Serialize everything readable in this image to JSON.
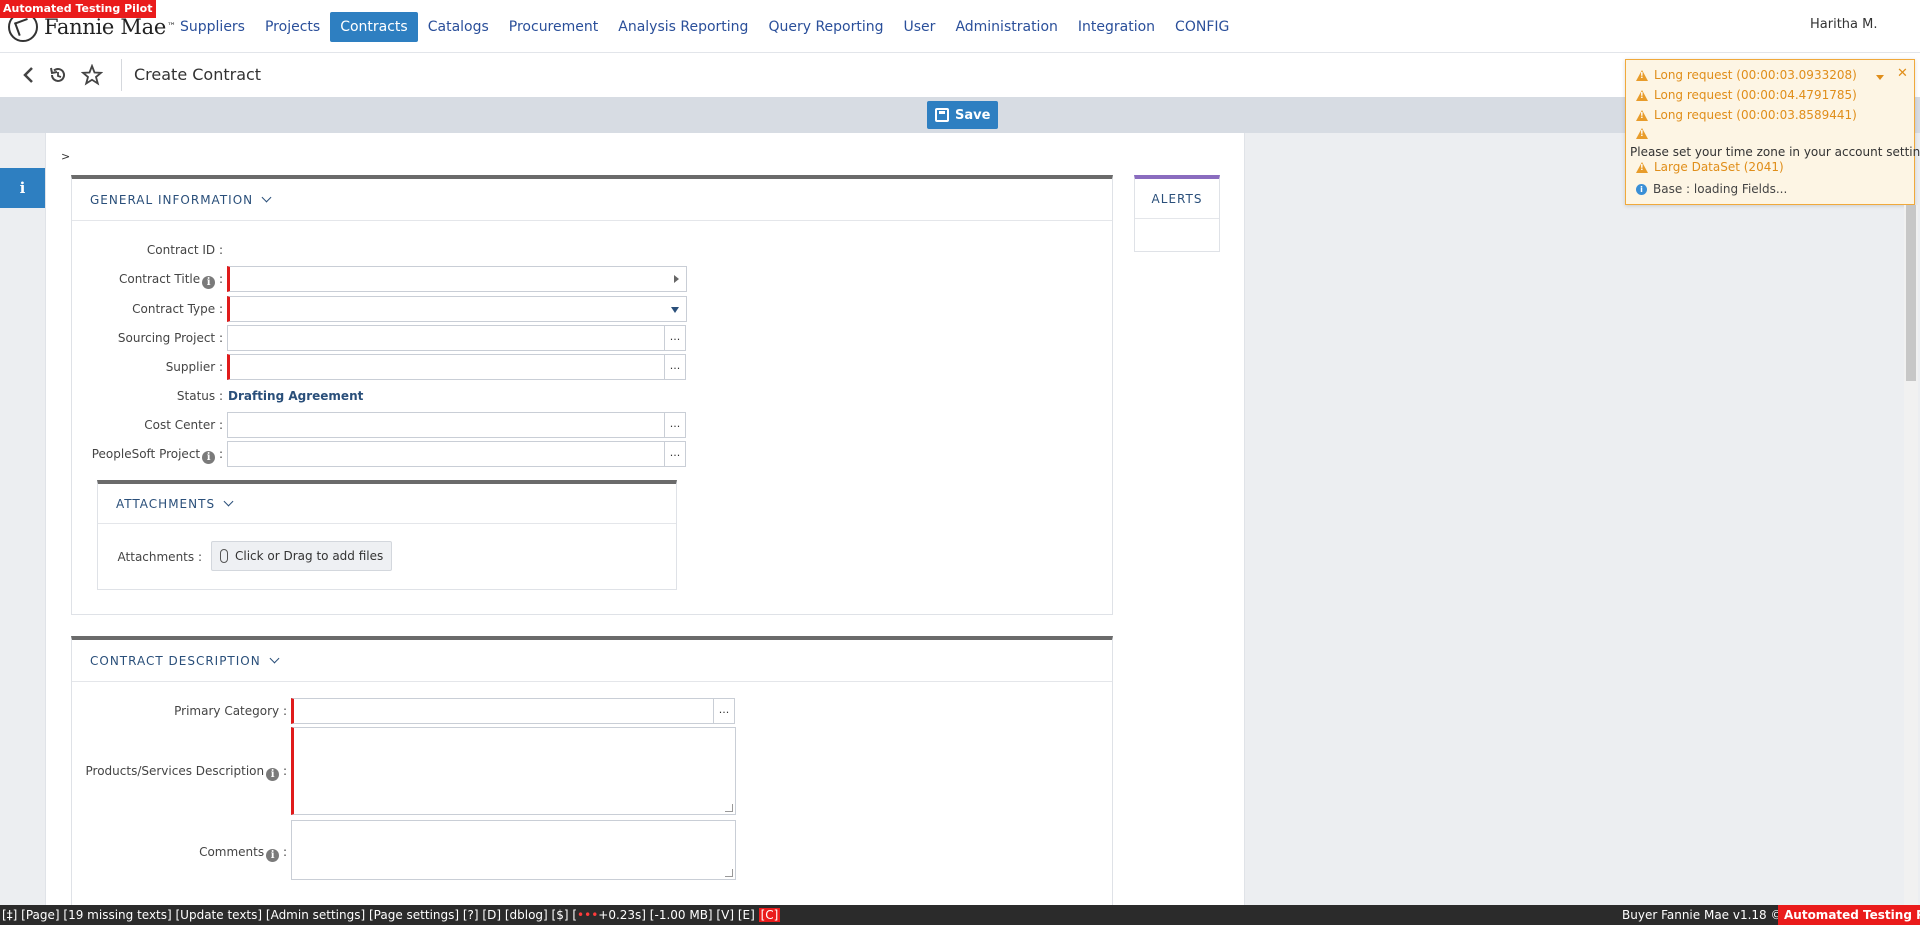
{
  "badges": {
    "top": "Automated Testing Pilot",
    "bottom": "Automated Testing Pilot"
  },
  "brand": {
    "logo_text": "Fannie Mae",
    "trademark": "™"
  },
  "nav": {
    "items": [
      {
        "label": "Suppliers"
      },
      {
        "label": "Projects"
      },
      {
        "label": "Contracts",
        "active": true
      },
      {
        "label": "Catalogs"
      },
      {
        "label": "Procurement"
      },
      {
        "label": "Analysis Reporting"
      },
      {
        "label": "Query Reporting"
      },
      {
        "label": "User"
      },
      {
        "label": "Administration"
      },
      {
        "label": "Integration"
      },
      {
        "label": "CONFIG"
      }
    ],
    "user": "Haritha M."
  },
  "titlebar": {
    "back_icon": "chevron-left-icon",
    "history_icon": "history-icon",
    "favorite_icon": "star-icon",
    "title": "Create Contract"
  },
  "toolbar": {
    "save_label": "Save",
    "save_icon": "floppy-disk-icon"
  },
  "left_rail": {
    "info_label": "i"
  },
  "path_marker": ">",
  "general_info": {
    "title": "GENERAL INFORMATION",
    "fields": {
      "contract_id": "Contract ID :",
      "contract_title": "Contract Title",
      "contract_type": "Contract Type :",
      "sourcing_project": "Sourcing Project :",
      "supplier": "Supplier :",
      "status": "Status :",
      "cost_center": "Cost Center :",
      "peoplesoft_project": "PeopleSoft Project"
    },
    "colon": ":",
    "status_value": "Drafting Agreement",
    "dots": "..."
  },
  "attachments": {
    "title": "ATTACHMENTS",
    "label": "Attachments :",
    "button": "Click or Drag to add files"
  },
  "contract_description": {
    "title": "CONTRACT DESCRIPTION",
    "primary_category": "Primary Category :",
    "products_services": "Products/Services Description",
    "comments": "Comments",
    "colon": ":",
    "dots": "..."
  },
  "alerts": {
    "title": "ALERTS"
  },
  "notifications": {
    "items": [
      "Long request (00:00:03.0933208)",
      "Long request (00:00:04.4791785)",
      "Long request (00:00:03.8589441)"
    ],
    "timezone_msg": "Please set your time zone in your account settings",
    "large_dataset": "Large DataSet (2041)",
    "loading": "Base : loading Fields...",
    "colors": {
      "warning": "#e08e1a",
      "info": "#3a8fd6"
    }
  },
  "debugbar": {
    "part1": "[‡] [Page] [19 missing texts] [Update texts] [Admin settings] [Page settings] [?] [D] [dblog] [$] [",
    "red_part": "•••",
    "part2": "+0.23s] [-1.00 MB] [V] [E] ",
    "c_label": "[C]",
    "right": "Buyer Fannie Mae v1.18 ©"
  },
  "colors": {
    "accent": "#2e7fc1",
    "nav_text": "#2a4f9a",
    "required": "#e01b1b"
  }
}
